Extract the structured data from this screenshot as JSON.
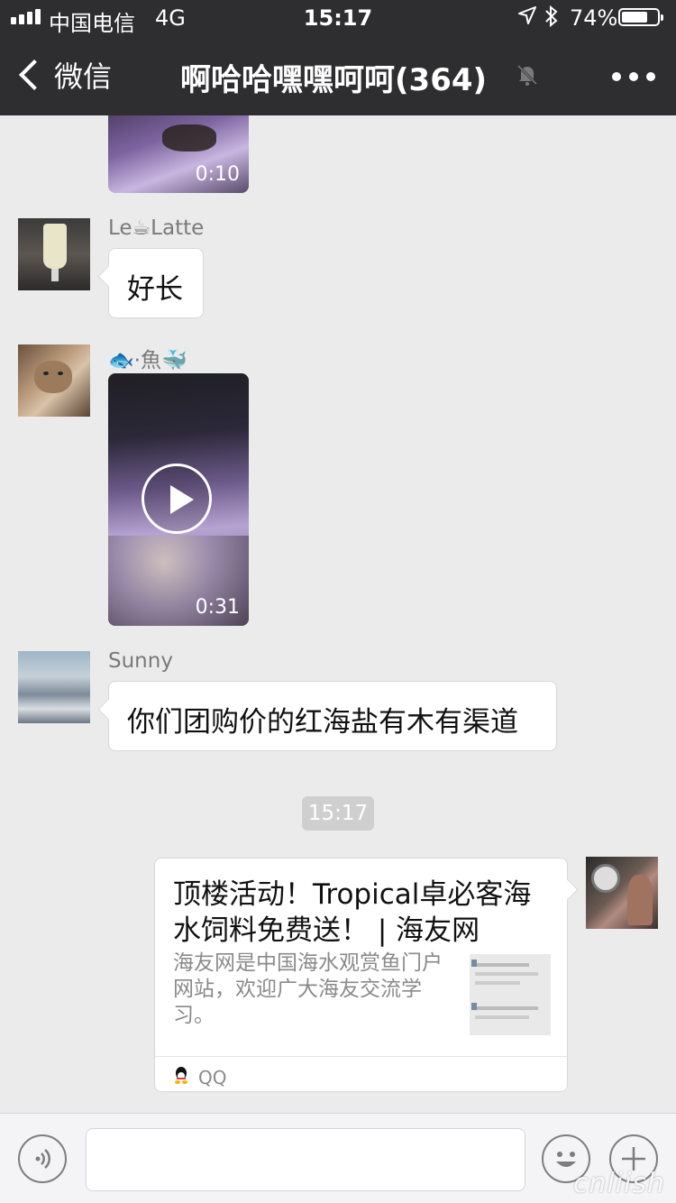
{
  "status_bar": {
    "carrier": "中国电信",
    "network": "4G",
    "time": "15:17",
    "battery_percent": "74%",
    "battery_level": 0.74
  },
  "nav": {
    "back_label": "微信",
    "title": "啊哈哈嘿嘿呵呵(364)"
  },
  "messages": {
    "video1": {
      "duration": "0:10"
    },
    "latte": {
      "sender": "Le☕Latte",
      "text": "好长"
    },
    "fish": {
      "sender": "🐟·魚🐳",
      "duration": "0:31"
    },
    "sunny": {
      "sender": "Sunny",
      "text": "你们团购价的红海盐有木有渠道"
    },
    "time_divider": "15:17",
    "link": {
      "title": "顶楼活动！Tropical卓必客海水饲料免费送！ | 海友网",
      "description": "海友网是中国海水观赏鱼门户网站，欢迎广大海友交流学习。",
      "source": "QQ"
    }
  },
  "input_bar": {
    "voice_icon": "voice-icon",
    "emoji_icon": "emoji-icon",
    "plus_icon": "plus-icon"
  },
  "watermark": "cnliish"
}
